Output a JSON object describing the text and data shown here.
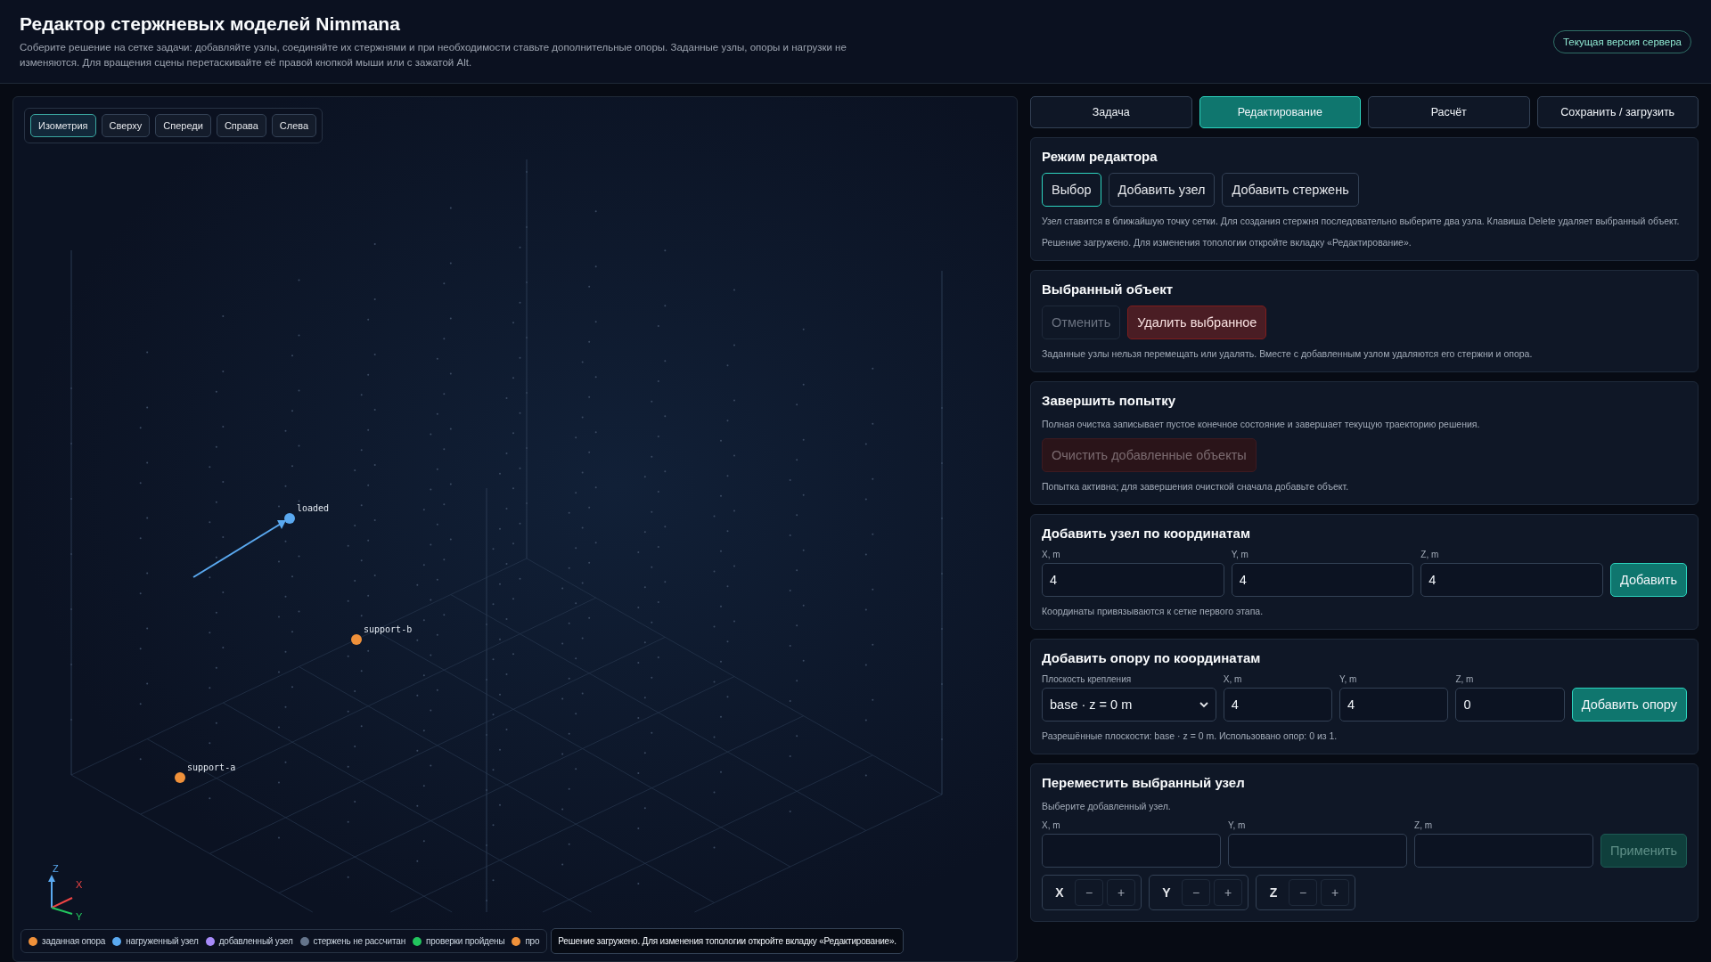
{
  "header": {
    "title": "Редактор стержневых моделей Nimmana",
    "subtitle": "Соберите решение на сетке задачи: добавляйте узлы, соединяйте их стержнями и при необходимости ставьте дополнительные опоры. Заданные узлы, опоры и нагрузки не изменяются. Для вращения сцены перетаскивайте её правой кнопкой мыши или с зажатой Alt.",
    "server_button": "Текущая версия сервера"
  },
  "viewport": {
    "views": [
      {
        "label": "Изометрия",
        "selected": true
      },
      {
        "label": "Сверху",
        "selected": false
      },
      {
        "label": "Спереди",
        "selected": false
      },
      {
        "label": "Справа",
        "selected": false
      },
      {
        "label": "Слева",
        "selected": false
      }
    ],
    "nodes": [
      {
        "label": "loaded",
        "kind": "loaded"
      },
      {
        "label": "support-b",
        "kind": "support"
      },
      {
        "label": "support-a",
        "kind": "support"
      }
    ],
    "axes": [
      "Z",
      "X",
      "Y"
    ],
    "legend": [
      {
        "label": "заданная опора",
        "color": "#f0913a"
      },
      {
        "label": "нагруженный узел",
        "color": "#5aa9f0"
      },
      {
        "label": "добавленный узел",
        "color": "#a78bfa"
      },
      {
        "label": "стержень не рассчитан",
        "color": "#64748b"
      },
      {
        "label": "проверки пройдены",
        "color": "#22c55e"
      },
      {
        "label": "про",
        "color": "#f0913a"
      }
    ],
    "toast": "Решение загружено. Для изменения топологии откройте вкладку «Редактирование»."
  },
  "tabs": [
    {
      "label": "Задача",
      "selected": false
    },
    {
      "label": "Редактирование",
      "selected": true
    },
    {
      "label": "Расчёт",
      "selected": false
    },
    {
      "label": "Сохранить / загрузить",
      "selected": false
    }
  ],
  "editor_mode": {
    "title": "Режим редактора",
    "modes": [
      {
        "label": "Выбор",
        "selected": true
      },
      {
        "label": "Добавить узел",
        "selected": false
      },
      {
        "label": "Добавить стержень",
        "selected": false
      }
    ],
    "hint": "Узел ставится в ближайшую точку сетки. Для создания стержня последовательно выберите два узла. Клавиша Delete удаляет выбранный объект.",
    "status": "Решение загружено. Для изменения топологии откройте вкладку «Редактирование»."
  },
  "selected_object": {
    "title": "Выбранный объект",
    "buttons": [
      {
        "label": "Отменить",
        "kind": "plain",
        "disabled": true
      },
      {
        "label": "Удалить выбранное",
        "kind": "danger",
        "disabled": false
      }
    ],
    "hint": "Заданные узлы нельзя перемещать или удалять. Вместе с добавленным узлом удаляются его стержни и опора."
  },
  "finish_attempt": {
    "title": "Завершить попытку",
    "hint": "Полная очистка записывает пустое конечное состояние и завершает текущую траекторию решения.",
    "button": {
      "label": "Очистить добавленные объекты",
      "kind": "danger",
      "disabled": true
    },
    "status": "Попытка активна; для завершения очисткой сначала добавьте объект."
  },
  "add_node": {
    "title": "Добавить узел по координатам",
    "fields": [
      {
        "label": "X, m",
        "value": "4"
      },
      {
        "label": "Y, m",
        "value": "4"
      },
      {
        "label": "Z, m",
        "value": "4"
      }
    ],
    "button": {
      "label": "Добавить",
      "kind": "primary",
      "disabled": false
    },
    "hint": "Координаты привязываются к сетке первого этапа."
  },
  "add_support": {
    "title": "Добавить опору по координатам",
    "plane": {
      "label": "Плоскость крепления",
      "value": "base · z = 0 m"
    },
    "fields": [
      {
        "label": "X, m",
        "value": "4"
      },
      {
        "label": "Y, m",
        "value": "4"
      },
      {
        "label": "Z, m",
        "value": "0"
      }
    ],
    "button": {
      "label": "Добавить опору",
      "kind": "primary",
      "disabled": false
    },
    "hint": "Разрешённые плоскости: base · z = 0 m. Использовано опор: 0 из 1."
  },
  "move_node": {
    "title": "Переместить выбранный узел",
    "hint": "Выберите добавленный узел.",
    "fields": [
      {
        "label": "X, m"
      },
      {
        "label": "Y, m"
      },
      {
        "label": "Z, m"
      }
    ],
    "button": {
      "label": "Применить",
      "kind": "primary",
      "disabled": true
    },
    "steppers": [
      {
        "axis": "X",
        "minus": "−",
        "plus": "+"
      },
      {
        "axis": "Y",
        "minus": "−",
        "plus": "+"
      },
      {
        "axis": "Z",
        "minus": "−",
        "plus": "+"
      }
    ]
  }
}
